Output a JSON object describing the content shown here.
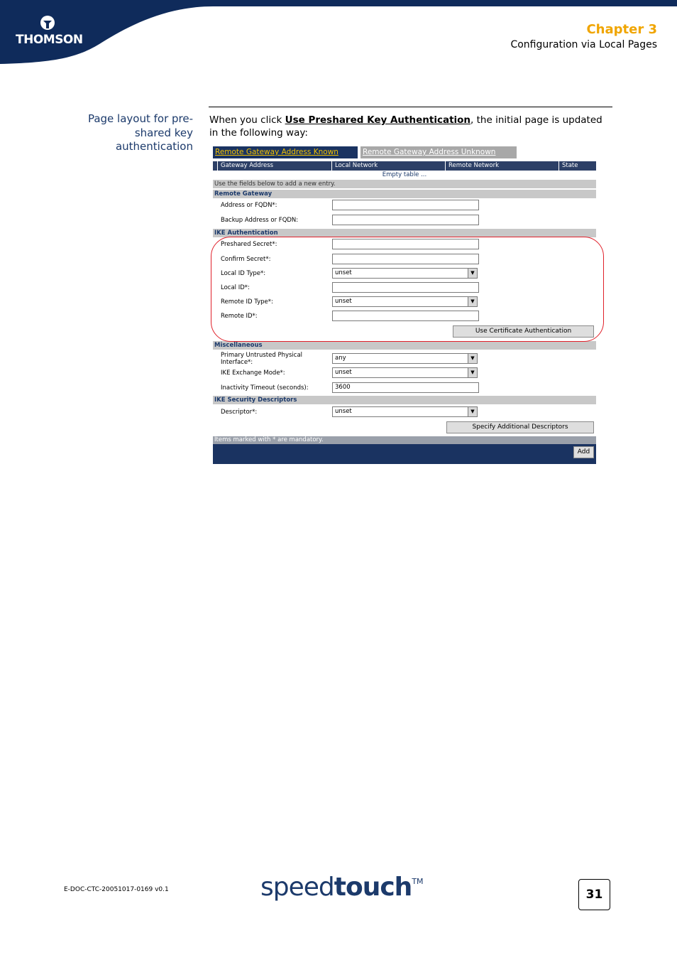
{
  "header": {
    "logo_text": "THOMSON",
    "chapter": "Chapter 3",
    "chapter_subtitle": "Configuration via Local Pages",
    "colors": {
      "navy": "#0f2b5b",
      "accent": "#f0a500"
    }
  },
  "section": {
    "side_heading_lines": [
      "Page layout for pre-",
      "shared key",
      "authentication"
    ],
    "intro_pre": "When you click ",
    "intro_link": "Use Preshared Key Authentication",
    "intro_post": ", the initial page is updated in the following way:"
  },
  "screenshot": {
    "tabs": [
      "Remote Gateway Address Known",
      "Remote Gateway Address Unknown"
    ],
    "columns": [
      "Gateway Address",
      "Local Network",
      "Remote Network",
      "State"
    ],
    "empty_text": "Empty table ...",
    "hint": "Use the fields below to add a new entry.",
    "remote_gateway": {
      "title": "Remote Gateway",
      "address_label": "Address or FQDN*:",
      "backup_label": "Backup Address or FQDN:"
    },
    "ike_auth": {
      "title": "IKE Authentication",
      "preshared_label": "Preshared Secret*:",
      "confirm_label": "Confirm Secret*:",
      "local_id_type_label": "Local ID Type*:",
      "local_id_type_value": "unset",
      "local_id_label": "Local ID*:",
      "remote_id_type_label": "Remote ID Type*:",
      "remote_id_type_value": "unset",
      "remote_id_label": "Remote ID*:",
      "cert_button": "Use Certificate Authentication"
    },
    "misc": {
      "title": "Miscellaneous",
      "primary_label": "Primary Untrusted Physical Interface*:",
      "primary_value": "any",
      "exchange_label": "IKE Exchange Mode*:",
      "exchange_value": "unset",
      "timeout_label": "Inactivity Timeout (seconds):",
      "timeout_value": "3600"
    },
    "descriptors": {
      "title": "IKE Security Descriptors",
      "descriptor_label": "Descriptor*:",
      "descriptor_value": "unset",
      "specify_button": "Specify Additional Descriptors"
    },
    "mandatory_note": "Items marked with * are mandatory.",
    "add_button": "Add"
  },
  "footer": {
    "doc_id": "E-DOC-CTC-20051017-0169 v0.1",
    "brand_part1": "speed",
    "brand_part2": "touch",
    "brand_tm": "TM",
    "page_number": "31"
  }
}
